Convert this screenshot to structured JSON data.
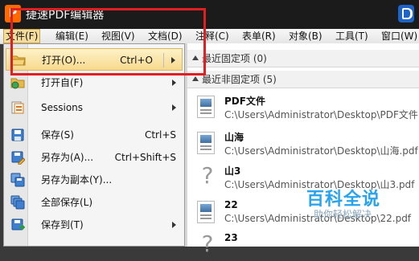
{
  "window": {
    "title": "捷速PDF编辑器",
    "app_logo_text": "P"
  },
  "menubar": {
    "items": [
      "文件(F)",
      "编辑(E)",
      "视图(V)",
      "文档(D)",
      "注释(C)",
      "表单(R)",
      "对象(B)",
      "工具(T)",
      "窗口(W)"
    ]
  },
  "file_menu": {
    "items": [
      {
        "label": "打开(O)...",
        "shortcut": "Ctrl+O",
        "icon": "folder-open-icon"
      },
      {
        "label": "打开自(F)",
        "shortcut": "",
        "icon": "folder-globe-icon"
      },
      {
        "label": "Sessions",
        "shortcut": "",
        "icon": "sessions-icon"
      },
      {
        "label": "保存(S)",
        "shortcut": "Ctrl+S",
        "icon": "save-icon"
      },
      {
        "label": "另存为(A)...",
        "shortcut": "Ctrl+Shift+S",
        "icon": "save-as-icon"
      },
      {
        "label": "另存为副本(Y)...",
        "shortcut": "",
        "icon": "save-copy-icon"
      },
      {
        "label": "全部保存(L)",
        "shortcut": "",
        "icon": "save-all-icon"
      },
      {
        "label": "保存到(T)",
        "shortcut": "",
        "icon": "save-to-icon"
      }
    ]
  },
  "recent_panel": {
    "pinned_header": "最近固定项 (0)",
    "unpinned_header": "最近非固定项 (5)",
    "files": [
      {
        "name": "PDF文件",
        "path": "C:\\Users\\Administrator\\Desktop\\PDF文件.",
        "icon": "pdf-thumbnail-icon"
      },
      {
        "name": "山海",
        "path": "C:\\Users\\Administrator\\Desktop\\山海.pdf",
        "icon": "pdf-thumbnail-icon"
      },
      {
        "name": "山3",
        "path": "C:\\Users\\Administrator\\Desktop\\山3.pdf",
        "icon": "unknown-file-icon"
      },
      {
        "name": "22",
        "path": "C:\\Users\\Administrator\\Desktop\\22.pdf",
        "icon": "pdf-thumbnail-icon"
      },
      {
        "name": "23",
        "path": "",
        "icon": "unknown-file-icon"
      }
    ]
  },
  "watermark": {
    "title": "百科全说",
    "subtitle": "助你轻松解决"
  },
  "colors": {
    "highlight": "#f6d98d",
    "annotation": "#e02020",
    "watermark": "#28a4ee"
  }
}
